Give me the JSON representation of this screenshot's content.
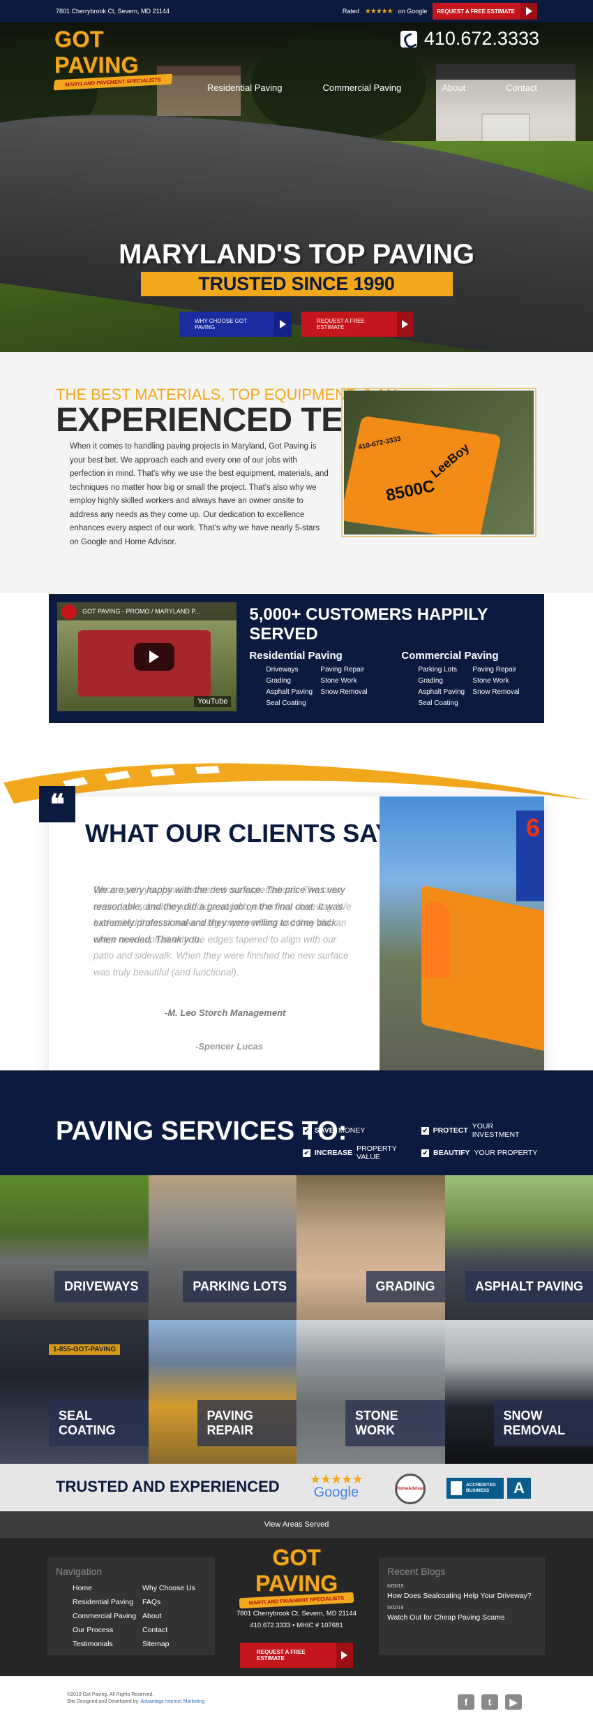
{
  "topbar": {
    "address": "7801 Cherrybrook Ct, Severn, MD 21144",
    "rated": "Rated",
    "stars": "★★★★★",
    "on_google": "on Google",
    "cta": "REQUEST A FREE ESTIMATE"
  },
  "brand": {
    "name": "GOT PAVING",
    "tagline": "MARYLAND PAVEMENT SPECIALISTS",
    "phone": "410.672.3333",
    "accent": "#f2a81d",
    "navy": "#0b1b3f",
    "red": "#c4161c"
  },
  "nav": [
    "Residential Paving",
    "Commercial Paving",
    "About",
    "Contact"
  ],
  "hero": {
    "title": "MARYLAND'S TOP PAVING",
    "subtitle": "TRUSTED SINCE 1990",
    "btn_why": "WHY CHOOSE GOT PAVING",
    "btn_estimate": "REQUEST A FREE ESTIMATE"
  },
  "experienced": {
    "kicker": "THE BEST MATERIALS, TOP EQUIPMENT, & AN",
    "heading": "EXPERIENCED TEAM",
    "body": "When it comes to handling paving projects in Maryland, Got Paving is your best bet. We approach each and every one of our jobs with perfection in mind. That's why we use the best equipment, materials, and techniques no matter how big or small the project. That's also why we employ highly skilled workers and always have an owner onsite to address any needs as they come up. Our dedication to excellence enhances every aspect of our work. That's why we have nearly 5-stars on Google and Home Advisor.",
    "photo_text": [
      "410-672-3333",
      "8500C",
      "LeeBoy"
    ]
  },
  "customers": {
    "video_title": "GOT PAVING - PROMO / MARYLAND P...",
    "video_brand": "YouTube",
    "title": "5,000+ CUSTOMERS HAPPILY SERVED",
    "residential": {
      "heading": "Residential Paving",
      "items": [
        "Driveways",
        "Paving Repair",
        "Grading",
        "Stone Work",
        "Asphalt Paving",
        "Snow Removal",
        "Seal Coating"
      ]
    },
    "commercial": {
      "heading": "Commercial Paving",
      "items": [
        "Parking Lots",
        "Paving Repair",
        "Grading",
        "Stone Work",
        "Asphalt Paving",
        "Snow Removal",
        "Seal Coating"
      ]
    }
  },
  "testimonials": {
    "heading": "WHAT OUR CLIENTS SAY",
    "quote_icon": "❝",
    "quote_a": "We are very happy with the new surface. The price was very reasonable, and they did a great job on the final coat. It was extremely professional and they were willing to come back when needed. Thank you.",
    "quote_b": "Once again you have exceeded our expectations. The crew arrived on schedule and did a superb job on our driveway. We had asked them to make a big improvement and they did: an entire new asphalt with the edges tapered to align with our patio and sidewalk. When they were finished the new surface was truly beautiful (and functional).",
    "author_a": "-M. Leo Storch Management",
    "author_b": "-Spencer Lucas"
  },
  "services": {
    "heading": "PAVING SERVICES TO:",
    "benefits": [
      {
        "bold": "SAVE",
        "rest": " MONEY"
      },
      {
        "bold": "PROTECT",
        "rest": " YOUR INVESTMENT"
      },
      {
        "bold": "INCREASE",
        "rest": " PROPERTY VALUE"
      },
      {
        "bold": "BEAUTIFY",
        "rest": " YOUR PROPERTY"
      }
    ],
    "tiles": [
      "DRIVEWAYS",
      "PARKING LOTS",
      "GRADING",
      "ASPHALT PAVING",
      "SEAL COATING",
      "PAVING REPAIR",
      "STONE WORK",
      "SNOW REMOVAL"
    ],
    "tile_sign": "1-855-GOT-PAVING"
  },
  "trusted": {
    "heading": "TRUSTED AND EXPERIENCED",
    "google_stars": "★★★★★",
    "google": "Google",
    "homeadvisor": "HomeAdvisor",
    "bbb": "ACCREDITED BUSINESS",
    "bbb_grade": "A"
  },
  "areas": {
    "label": "View Areas Served"
  },
  "footer": {
    "nav_heading": "Navigation",
    "nav_items": [
      "Home",
      "Why Choose Us",
      "Residential Paving",
      "FAQs",
      "Commercial Paving",
      "About",
      "Our Process",
      "Contact",
      "Testimonials",
      "Sitemap"
    ],
    "address": "7801 Cherrybrook Ct, Severn, MD 21144",
    "phone_line": "410.672.3333 • MHIC # 107681",
    "cta": "REQUEST A FREE ESTIMATE",
    "blogs_heading": "Recent Blogs",
    "blogs": [
      {
        "date": "6/03/19",
        "title": "How Does Sealcoating Help Your Driveway?"
      },
      {
        "date": "5/02/19",
        "title": "Watch Out for Cheap Paving Scams"
      }
    ]
  },
  "bottom": {
    "copyright": "©2019 Got Paving. All Rights Reserved.",
    "credit_prefix": "Site Designed and Developed by:",
    "credit_link": "Advantage Internet Marketing",
    "social": [
      "f",
      "t",
      "▶"
    ]
  }
}
